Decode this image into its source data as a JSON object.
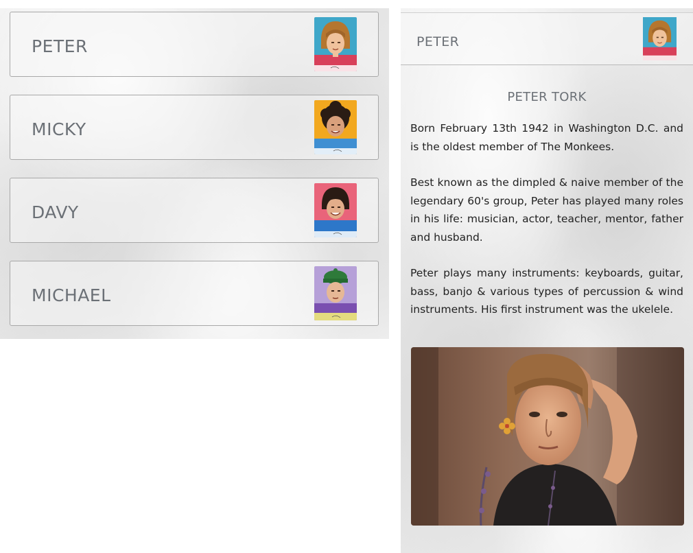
{
  "members_list": {
    "items": [
      {
        "label": "PETER",
        "portrait_icon": "peter-portrait-icon"
      },
      {
        "label": "MICKY",
        "portrait_icon": "micky-portrait-icon"
      },
      {
        "label": "DAVY",
        "portrait_icon": "davy-portrait-icon"
      },
      {
        "label": "MICHAEL",
        "portrait_icon": "michael-portrait-icon"
      }
    ]
  },
  "detail": {
    "header_name": "PETER",
    "title": "PETER TORK",
    "paragraphs": [
      "Born February 13th 1942 in Washington D.C. and is the oldest member of The Monkees.",
      "Best known as the dimpled & naive member of the legendary 60's group, Peter has played many roles in his life: musician, actor, teacher, mentor, father and husband.",
      "Peter plays many instruments: keyboards, guitar, bass, banjo & various types of percussion & wind instruments. His first instrument was the ukelele."
    ],
    "photo_icon": "peter-photo"
  },
  "colors": {
    "label_text": "#6b7076",
    "body_text": "#222222",
    "card_border": "#a8a8a8"
  }
}
